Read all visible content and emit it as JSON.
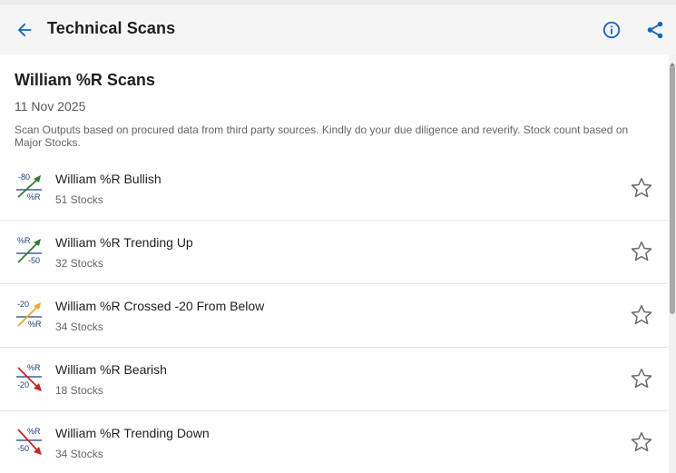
{
  "header": {
    "title": "Technical Scans",
    "back_icon": "arrow-left-icon",
    "info_icon": "info-icon",
    "share_icon": "share-icon",
    "accent_color": "#1565c0"
  },
  "page": {
    "title": "William %R Scans",
    "date": "11 Nov 2025",
    "disclaimer": "Scan Outputs based on procured data from third party sources. Kindly do your due diligence and reverify. Stock count based on Major Stocks."
  },
  "scans": [
    {
      "name": "William %R Bullish",
      "count": "51 Stocks",
      "icon_top": "-80",
      "icon_bottom": "%R",
      "icon": "bullish-cross-icon",
      "trend": "up",
      "color": "#2e7d32"
    },
    {
      "name": "William %R Trending Up",
      "count": "32 Stocks",
      "icon_top": "%R",
      "icon_bottom": "-50",
      "icon": "trending-up-icon",
      "trend": "up",
      "color": "#2e7d32"
    },
    {
      "name": "William %R Crossed -20 From Below",
      "count": "34 Stocks",
      "icon_top": "-20",
      "icon_bottom": "%R",
      "icon": "crossed-above-icon",
      "trend": "up",
      "color": "#f5a623"
    },
    {
      "name": "William %R Bearish",
      "count": "18 Stocks",
      "icon_top": "%R",
      "icon_bottom": "-20",
      "icon": "bearish-cross-icon",
      "trend": "down",
      "color": "#c62828"
    },
    {
      "name": "William %R Trending Down",
      "count": "34 Stocks",
      "icon_top": "%R",
      "icon_bottom": "-50",
      "icon": "trending-down-icon",
      "trend": "down",
      "color": "#c62828"
    }
  ],
  "star_icon": "star-outline-icon"
}
